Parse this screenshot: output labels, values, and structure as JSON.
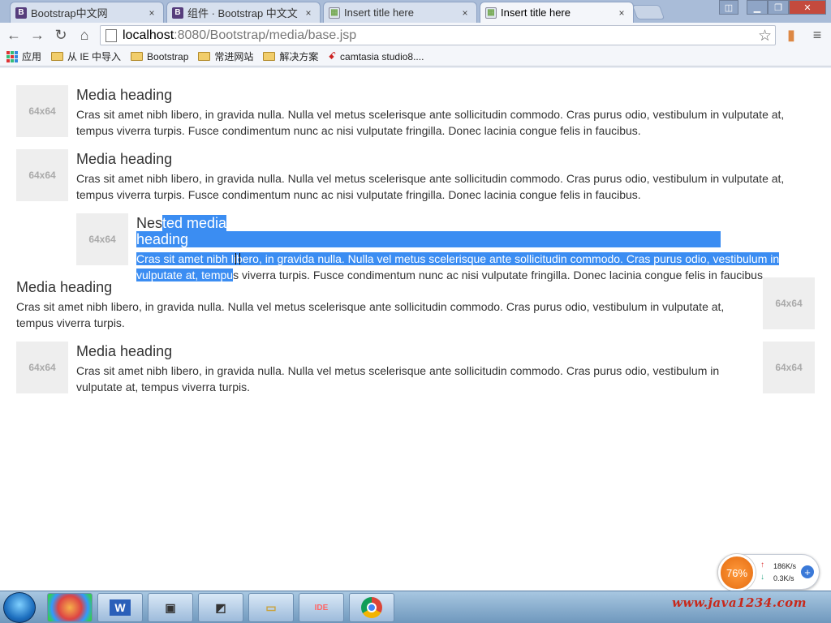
{
  "browser": {
    "tabs": [
      {
        "title": "Bootstrap中文网",
        "favicon": "B",
        "close": "×"
      },
      {
        "title": "组件 · Bootstrap 中文文",
        "favicon": "B",
        "close": "×"
      },
      {
        "title": "Insert title here",
        "favicon": "image-icon",
        "close": "×"
      },
      {
        "title": "Insert title here",
        "favicon": "image-icon",
        "close": "×"
      }
    ],
    "url_host": "localhost",
    "url_rest": ":8080/Bootstrap/media/base.jsp",
    "bookmarks": [
      "应用",
      "从 IE 中导入",
      "Bootstrap",
      "常进网站",
      "解决方案",
      "camtasia studio8...."
    ]
  },
  "media": {
    "thumb_label": "64x64",
    "heading": "Media heading",
    "nested_heading_sel_pre": "Nes",
    "nested_heading_sel": "ted media heading",
    "body_long": "Cras sit amet nibh libero, in gravida nulla. Nulla vel metus scelerisque ante sollicitudin commodo. Cras purus odio, vestibulum in vulputate at, tempus viverra turpis. Fusce condimentum nunc ac nisi vulputate fringilla. Donec lacinia congue felis in faucibus.",
    "nested_sel": "Cras sit amet nibh libero, in gravida nulla. Nulla vel metus scelerisque ante sollicitudin commodo. Cras purus odio, vestibulum in vulputate at, tempu",
    "nested_rest": "s viverra turpis. Fusce condimentum nunc ac nisi vulputate fringilla. Donec lacinia congue felis in faucibus.",
    "body_short": "Cras sit amet nibh libero, in gravida nulla. Nulla vel metus scelerisque ante sollicitudin commodo. Cras purus odio, vestibulum in vulputate at, tempus viverra turpis."
  },
  "tray": {
    "gauge": "76%",
    "up": "186K/s",
    "down": "0.3K/s",
    "watermark": "www.java1234.com"
  },
  "colors": {
    "selection": "#3b8df2",
    "thumb_bg": "#eeeeee",
    "text": "#333333"
  }
}
